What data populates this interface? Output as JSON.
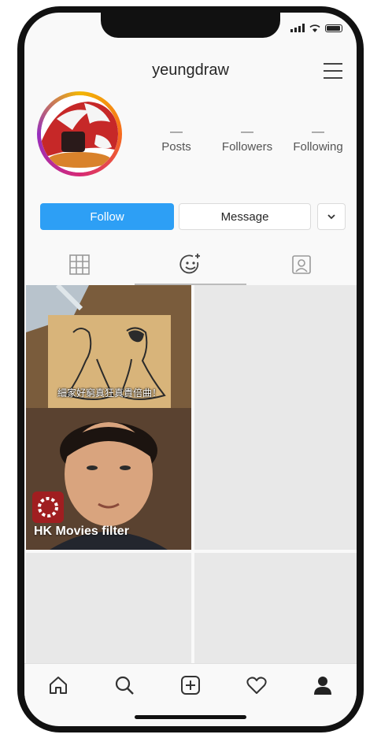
{
  "profile": {
    "username": "yeungdraw",
    "stats": [
      {
        "value": "—",
        "label": "Posts"
      },
      {
        "value": "—",
        "label": "Followers"
      },
      {
        "value": "—",
        "label": "Following"
      }
    ]
  },
  "actions": {
    "follow_label": "Follow",
    "message_label": "Message",
    "more_icon": "chevron-down-icon"
  },
  "tabs": [
    {
      "icon": "grid-icon",
      "active": false
    },
    {
      "icon": "effects-icon",
      "active": true
    },
    {
      "icon": "tagged-icon",
      "active": false
    }
  ],
  "effects": [
    {
      "name": "HK Movies filter",
      "sign_text": "細家好窮真狂真貴倍曲！"
    }
  ],
  "bottom_nav": [
    "home-icon",
    "search-icon",
    "add-icon",
    "heart-icon",
    "profile-icon"
  ],
  "colors": {
    "follow": "#2d9ff5",
    "badge": "#a01e20"
  }
}
